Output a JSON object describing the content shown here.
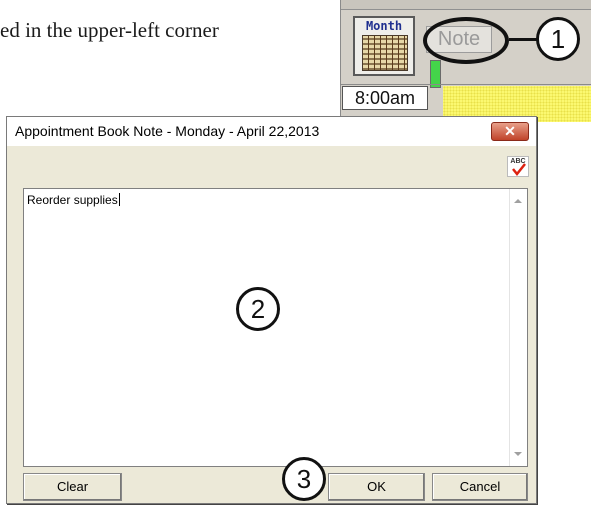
{
  "document": {
    "text_fragment": "ed in the upper-left corner"
  },
  "calendar": {
    "month_label": "Month",
    "note_button_label": "Note",
    "time_label": "8:00am"
  },
  "callouts": {
    "one": "1",
    "two": "2",
    "three": "3"
  },
  "dialog": {
    "title": "Appointment Book Note - Monday - April 22,2013",
    "close_symbol": "✕",
    "spellcheck_label": "ABC",
    "note_text": "Reorder supplies",
    "buttons": {
      "clear": "Clear",
      "ok": "OK",
      "cancel": "Cancel"
    }
  },
  "colors": {
    "dialog_bg": "#ece9d8",
    "close_button": "#c0432a",
    "calendar_highlight": "#fbf870",
    "indicator_green": "#44d44a"
  },
  "icons": [
    "spellcheck-icon",
    "close-icon",
    "scroll-up-icon",
    "scroll-down-icon",
    "month-calendar-icon"
  ]
}
